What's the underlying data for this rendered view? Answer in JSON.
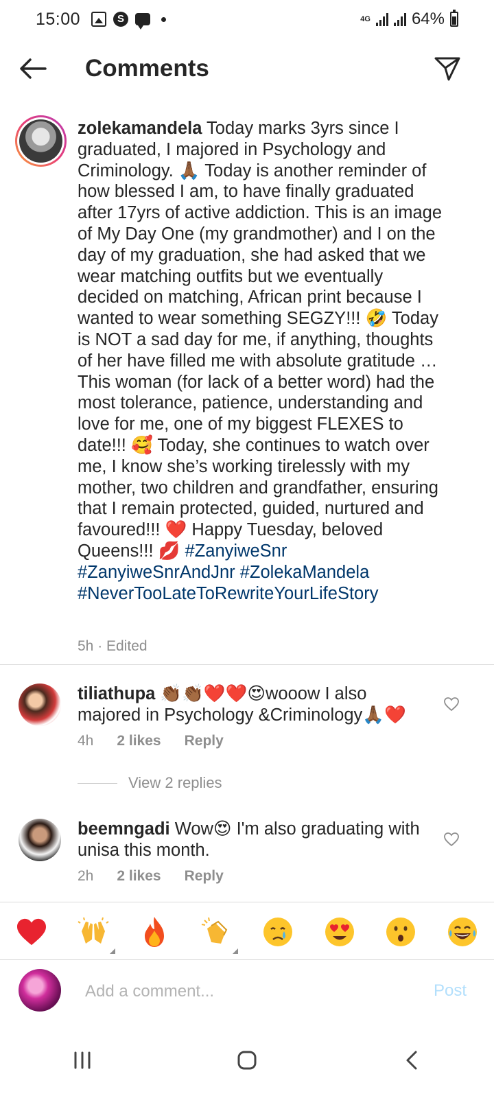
{
  "status_bar": {
    "time": "15:00",
    "network": "4G",
    "battery_percent": "64%",
    "battery_level": 0.64,
    "notification_icons": [
      "gallery-icon",
      "s-app-icon",
      "message-icon",
      "dot-icon"
    ]
  },
  "header": {
    "title": "Comments",
    "back_icon": "arrow-left-icon",
    "share_icon": "send-icon"
  },
  "caption": {
    "username": "zolekamandela",
    "text": " Today marks 3yrs since I graduated, I majored in Psychology and Criminology. 🙏🏾 Today is another reminder of how blessed I am, to have finally graduated after 17yrs of active addiction. This is an image of My Day One (my grandmother) and I on the day of my graduation, she had asked that we wear matching outfits but we eventually decided on matching, African print because I wanted to wear something SEGZY!!! 🤣 Today is NOT a sad day for me, if anything, thoughts of her have filled me with absolute gratitude … This woman (for lack of a better word) had the most tolerance, patience, understanding and love for me, one of my biggest FLEXES to date!!! 🥰 Today, she continues to watch over me, I know she’s working tirelessly with my mother, two children and grandfather, ensuring that I remain protected, guided, nurtured and favoured!!! ❤️ Happy Tuesday, beloved Queens!!! 💋 ",
    "hashtags": [
      "#ZanyiweSnr",
      "#ZanyiweSnrAndJnr",
      "#ZolekaMandela",
      "#NeverTooLateToRewriteYourLifeStory"
    ],
    "meta": "5h · Edited"
  },
  "comments": [
    {
      "username": "tiliathupa",
      "text": " 👏🏾👏🏾❤️❤️😍wooow I also majored in Psychology &Criminology🙏🏾❤️",
      "time": "4h",
      "likes": "2 likes",
      "reply": "Reply"
    },
    {
      "username": "beemngadi",
      "text": " Wow😍 I'm also graduating with unisa this month.",
      "time": "2h",
      "likes": "2 likes",
      "reply": "Reply"
    }
  ],
  "view_replies": "View 2 replies",
  "emoji_bar": [
    "❤️",
    "🙌",
    "🔥",
    "👏",
    "😢",
    "😍",
    "😮",
    "😂"
  ],
  "input": {
    "placeholder": "Add a comment...",
    "post_label": "Post"
  },
  "nav_bar": {
    "icons": [
      "recent-apps-icon",
      "home-icon",
      "back-icon"
    ]
  }
}
